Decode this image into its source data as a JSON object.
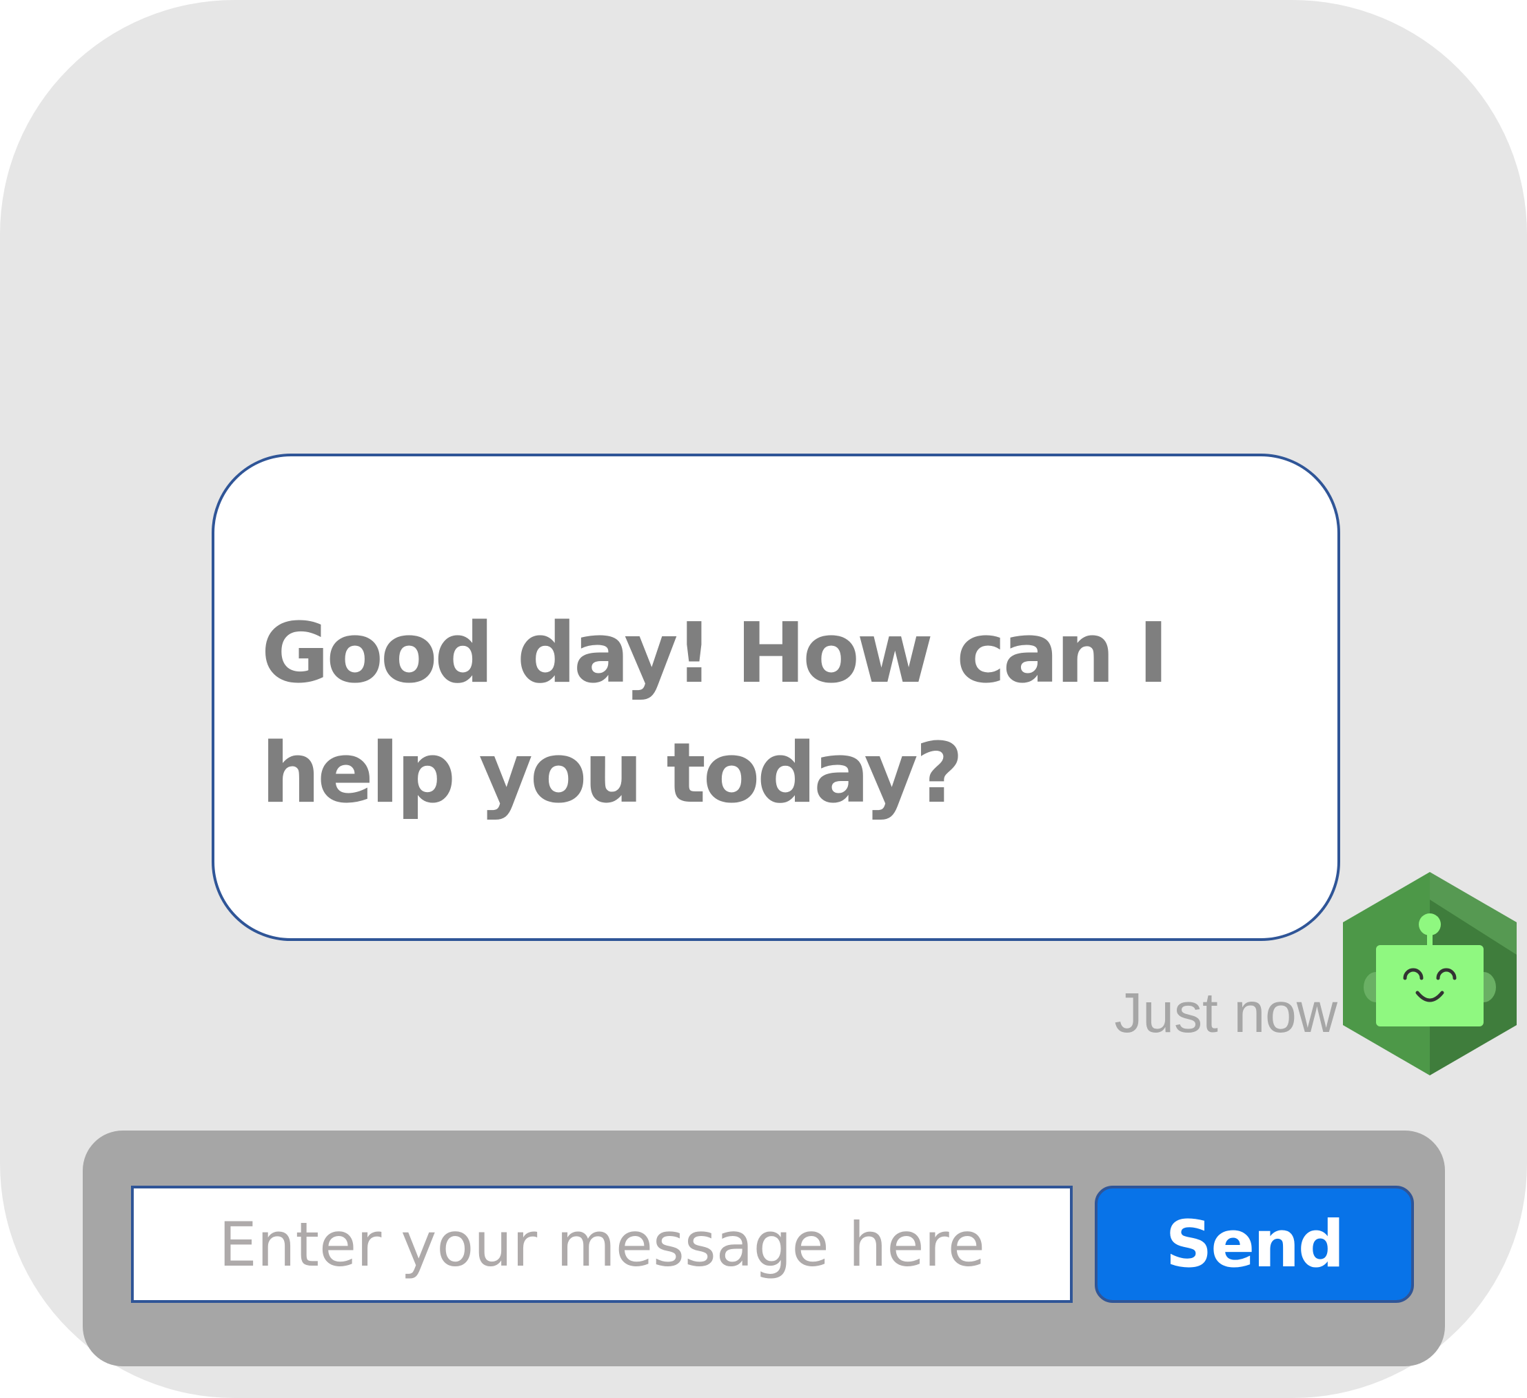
{
  "message": {
    "text": "Good day! How can I help you today?",
    "timestamp": "Just now"
  },
  "avatar": {
    "icon": "robot-icon"
  },
  "composer": {
    "placeholder": "Enter your message here",
    "value": "",
    "send_label": "Send"
  },
  "colors": {
    "window_background": "#e6e6e6",
    "bubble_border": "#2f5597",
    "message_text": "#7f7f7f",
    "timestamp_text": "#a6a6a6",
    "composer_bar": "#a6a6a6",
    "send_button": "#0873e8",
    "avatar_hex_dark": "#3f7d3c",
    "avatar_hex_light": "#6ab064",
    "robot_face": "#8ff880"
  }
}
